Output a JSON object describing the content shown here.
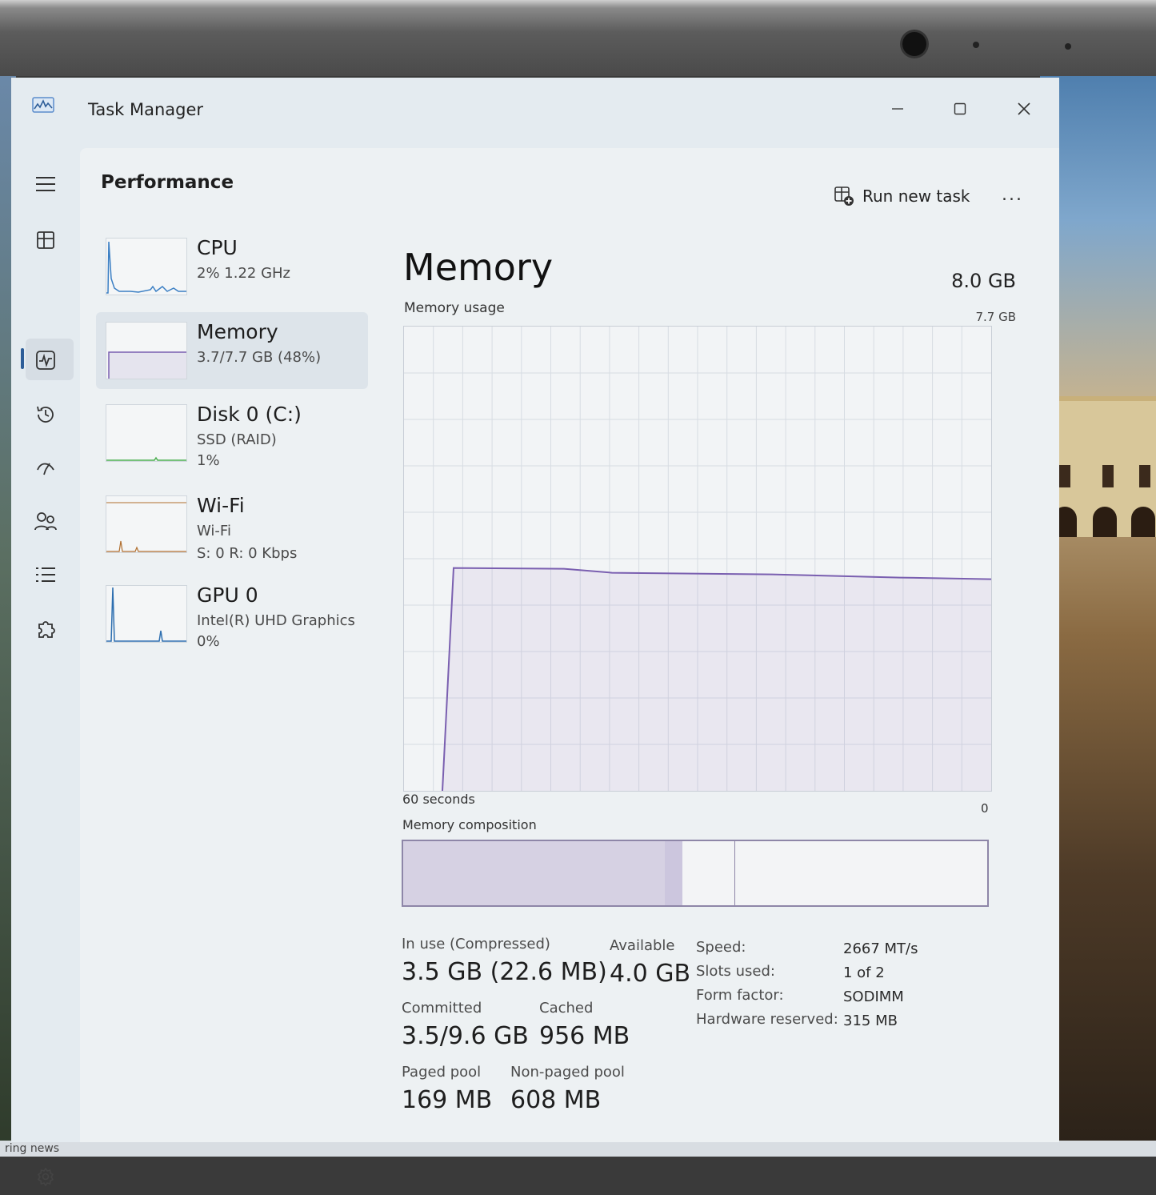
{
  "window": {
    "title": "Task Manager"
  },
  "header": {
    "page_title": "Performance",
    "run_new_task": "Run new task",
    "more": "..."
  },
  "devices": [
    {
      "name": "CPU",
      "line1": "2%  1.22 GHz",
      "line2": "",
      "line3": "",
      "graph_color": "#3b7fc4"
    },
    {
      "name": "Memory",
      "line1": "3.7/7.7 GB (48%)",
      "line2": "",
      "line3": "",
      "graph_color": "#7a5fb0"
    },
    {
      "name": "Disk 0 (C:)",
      "line1": "SSD (RAID)",
      "line2": "1%",
      "line3": "",
      "graph_color": "#4caf50"
    },
    {
      "name": "Wi-Fi",
      "line1": "Wi-Fi",
      "line2": "S: 0 R: 0 Kbps",
      "line3": "",
      "graph_color": "#b06e2e"
    },
    {
      "name": "GPU 0",
      "line1": "Intel(R) UHD Graphics",
      "line2": "0%",
      "line3": "",
      "graph_color": "#2e6fb0"
    }
  ],
  "detail": {
    "title": "Memory",
    "total": "8.0 GB",
    "usage_label": "Memory usage",
    "usage_max": "7.7 GB",
    "x_left": "60 seconds",
    "x_right": "0",
    "composition_label": "Memory composition",
    "accent": "#7a5fb0",
    "usage_fraction": 0.48,
    "composition": {
      "in_use_fraction": 0.45,
      "modified_fraction": 0.03,
      "standby_fraction": 0.09
    },
    "stats": {
      "in_use_label": "In use (Compressed)",
      "in_use_value": "3.5 GB (22.6 MB)",
      "available_label": "Available",
      "available_value": "4.0 GB",
      "committed_label": "Committed",
      "committed_value": "3.5/9.6 GB",
      "cached_label": "Cached",
      "cached_value": "956 MB",
      "paged_label": "Paged pool",
      "paged_value": "169 MB",
      "nonpaged_label": "Non-paged pool",
      "nonpaged_value": "608 MB"
    },
    "specs": {
      "speed_label": "Speed:",
      "speed_value": "2667 MT/s",
      "slots_label": "Slots used:",
      "slots_value": "1 of 2",
      "form_label": "Form factor:",
      "form_value": "SODIMM",
      "reserved_label": "Hardware reserved:",
      "reserved_value": "315 MB"
    }
  },
  "taskbar": {
    "news": "ring news"
  }
}
